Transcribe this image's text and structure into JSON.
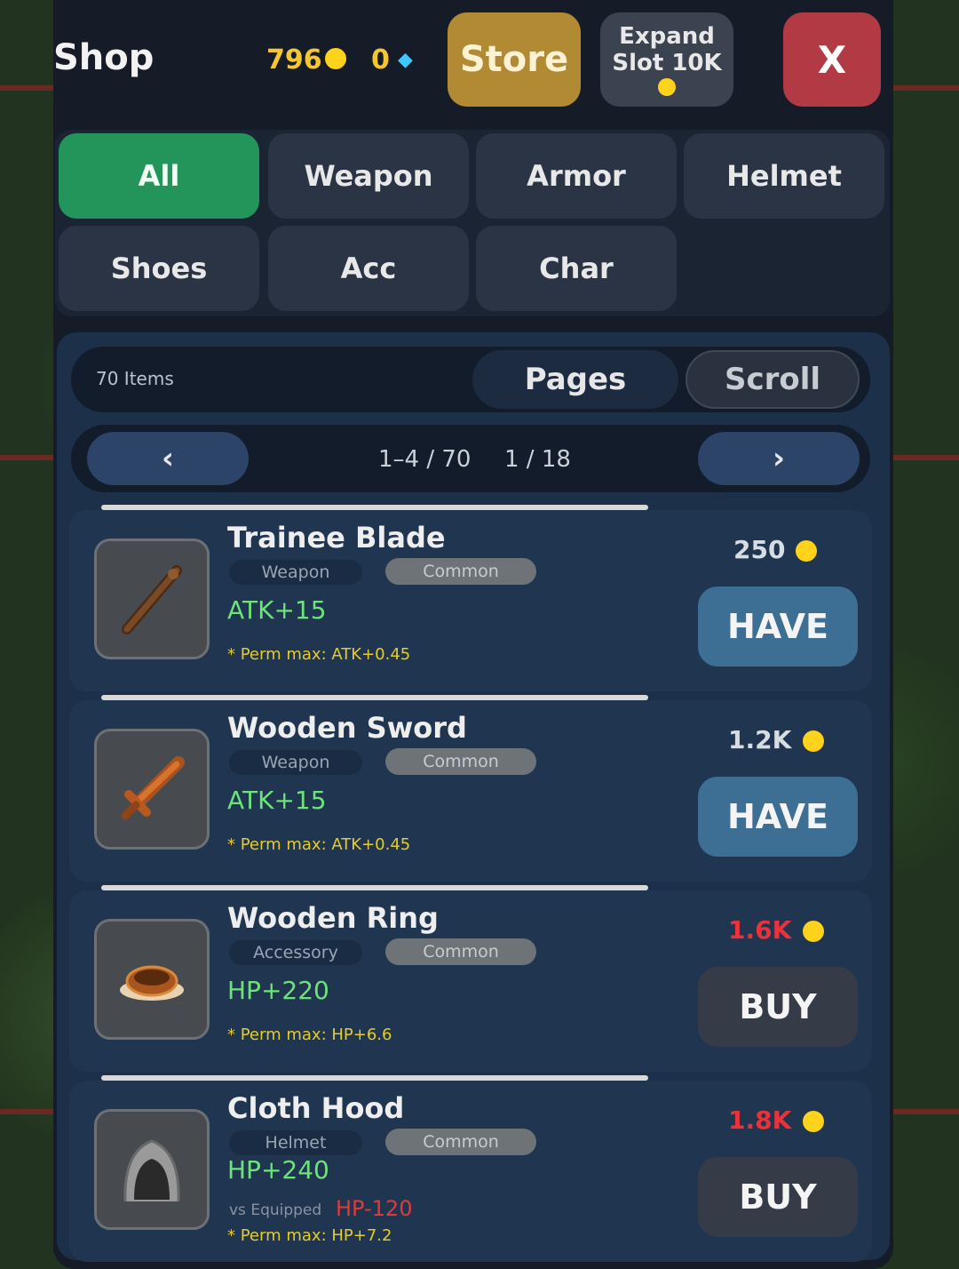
{
  "header": {
    "title": "Shop",
    "gold": "796",
    "gems": "0",
    "store_label": "Store",
    "expand_line1": "Expand",
    "expand_line2": "Slot 10K",
    "close_label": "X"
  },
  "categories": [
    {
      "label": "All",
      "active": true
    },
    {
      "label": "Weapon",
      "active": false
    },
    {
      "label": "Armor",
      "active": false
    },
    {
      "label": "Helmet",
      "active": false
    },
    {
      "label": "Shoes",
      "active": false
    },
    {
      "label": "Acc",
      "active": false
    },
    {
      "label": "Char",
      "active": false
    }
  ],
  "toolbar": {
    "items_count": "70 Items",
    "pages_label": "Pages",
    "scroll_label": "Scroll"
  },
  "pager": {
    "prev_label": "‹",
    "next_label": "›",
    "range": "1–4 / 70",
    "page": "1 / 18"
  },
  "items": [
    {
      "name": "Trainee Blade",
      "type": "Weapon",
      "rarity": "Common",
      "stat": "ATK+15",
      "note": "* Perm max: ATK+0.45",
      "price": "250",
      "price_affordable": true,
      "action": "HAVE",
      "icon": "club-icon"
    },
    {
      "name": "Wooden Sword",
      "type": "Weapon",
      "rarity": "Common",
      "stat": "ATK+15",
      "note": "* Perm max: ATK+0.45",
      "price": "1.2K",
      "price_affordable": true,
      "action": "HAVE",
      "icon": "sword-icon"
    },
    {
      "name": "Wooden Ring",
      "type": "Accessory",
      "rarity": "Common",
      "stat": "HP+220",
      "note": "* Perm max: HP+6.6",
      "price": "1.6K",
      "price_affordable": false,
      "action": "BUY",
      "icon": "ring-icon"
    },
    {
      "name": "Cloth Hood",
      "type": "Helmet",
      "rarity": "Common",
      "stat": "HP+240",
      "equipped_label": "vs Equipped",
      "delta": "HP-120",
      "note": "* Perm max: HP+7.2",
      "price": "1.8K",
      "price_affordable": false,
      "action": "BUY",
      "icon": "hood-icon"
    }
  ],
  "colors": {
    "panel": "#151c28",
    "tab_active": "#23955a",
    "store_button": "#b18a33",
    "close_button": "#b23a45",
    "have_button": "#3c6f93",
    "buy_button": "#353c47",
    "stat_green": "#6ee37a",
    "note_yellow": "#e6cc2a",
    "price_red": "#e8333a"
  }
}
